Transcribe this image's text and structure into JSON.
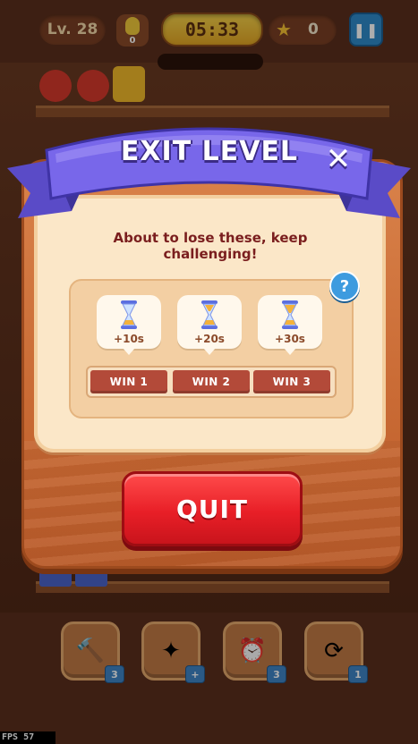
{
  "hud": {
    "level": "Lv. 28",
    "coins": "0",
    "timer": "05:33",
    "stars": "0",
    "pause_icon": "pause-icon"
  },
  "dialog": {
    "title": "EXIT LEVEL",
    "close_icon": "close-icon",
    "subtitle": "About to lose these, keep challenging!",
    "help_symbol": "?",
    "rewards": [
      {
        "icon": "hourglass-icon",
        "label": "+10s"
      },
      {
        "icon": "hourglass-icon",
        "label": "+20s"
      },
      {
        "icon": "hourglass-icon",
        "label": "+30s"
      }
    ],
    "wins": [
      "WIN 1",
      "WIN 2",
      "WIN 3"
    ],
    "quit_label": "QUIT"
  },
  "boosters": [
    {
      "icon": "hammer-icon",
      "count": "3"
    },
    {
      "icon": "magic-wand-icon",
      "count": "+"
    },
    {
      "icon": "alarm-clock-icon",
      "count": "3"
    },
    {
      "icon": "shuffle-icon",
      "count": "1"
    }
  ],
  "debug": {
    "fps": "FPS  57"
  },
  "colors": {
    "ribbon": "#6b5be0",
    "panel": "#fbe7c8",
    "quit_button": "#e81f27",
    "win_tab": "#b34a39",
    "help_badge": "#3d9bdf"
  }
}
